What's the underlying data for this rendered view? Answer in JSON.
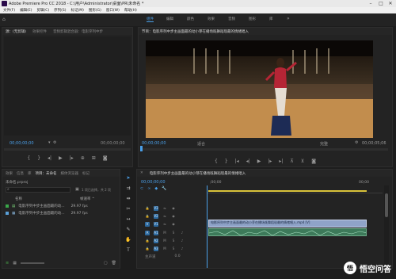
{
  "app": {
    "title": "Adobe Premiere Pro CC 2018 - C:\\用户\\Administrator\\桌面\\PR\\未命名 *"
  },
  "menu": [
    "文件(F)",
    "编辑(E)",
    "剪辑(C)",
    "序列(S)",
    "标记(M)",
    "图形(G)",
    "窗口(W)",
    "帮助(H)"
  ],
  "workspaces": [
    "组件",
    "编辑",
    "颜色",
    "效果",
    "音频",
    "图形",
    "库"
  ],
  "source_panel": {
    "tabs": [
      "源：(无剪辑)",
      "效果控件",
      "音频剪辑混合器：电影序列中步"
    ],
    "timecode": "00;00;00;00",
    "timecode_right": "00;00;00;00"
  },
  "program_panel": {
    "title": "节目：电影序列中步主画面最的动小芽在播场既舞蹈现最的情绪唱入",
    "timecode": "00;00;00;00",
    "fit_label": "适合",
    "ratio_label": "完整",
    "duration": "00;00;05;06"
  },
  "project_panel": {
    "tabs": [
      "项目：未命名",
      "媒体浏览器",
      "库",
      "信息",
      "效果",
      "标记"
    ],
    "filename": "未命名.prproj",
    "search_placeholder": "",
    "count_label": "1 项已选择，共 2 项",
    "col_name": "名称",
    "col_fps": "帧速率 ^",
    "items": [
      {
        "name": "电影序列中步主画面最的动...",
        "fps": "29.97 fps",
        "color": "#3aa84a"
      },
      {
        "name": "电影序列中步主画面最的动...",
        "fps": "29.97 fps",
        "color": "#5aa0d8"
      }
    ]
  },
  "timeline_panel": {
    "title": "电影序列中步主画面最的动小芽在播场既舞蹈现最的情绪唱入",
    "timecode": "00;00;00;00",
    "ruler_start": ";00;00",
    "ruler_end": "00;00",
    "tracks": [
      "V3",
      "V2",
      "V1",
      "A1",
      "A2",
      "A3",
      "主声道"
    ],
    "master_value": "0.0",
    "clip_label": "电影序列中步主画面最的动小芽在播场既舞蹈现最的情绪唱入.mp4 [V]"
  },
  "watermark": {
    "text": "悟空问答",
    "logo": "悟"
  }
}
